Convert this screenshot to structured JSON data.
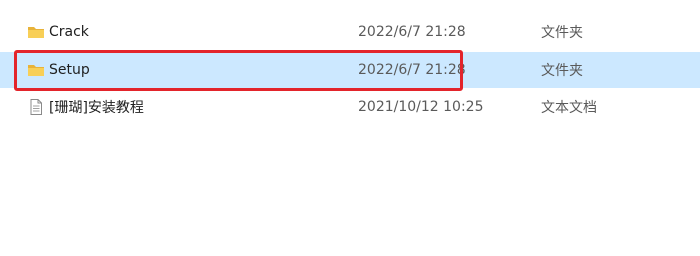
{
  "files": [
    {
      "name": "Crack",
      "date": "2022/6/7 21:28",
      "type": "文件夹",
      "icon": "folder-icon"
    },
    {
      "name": "Setup",
      "date": "2022/6/7 21:28",
      "type": "文件夹",
      "icon": "folder-icon",
      "selected": true
    },
    {
      "name": "[珊瑚]安装教程",
      "date": "2021/10/12 10:25",
      "type": "文本文档",
      "icon": "text-file-icon"
    }
  ],
  "colors": {
    "selection": "#cce8ff",
    "highlight_box": "#e3242b",
    "folder": "#f5c542"
  }
}
